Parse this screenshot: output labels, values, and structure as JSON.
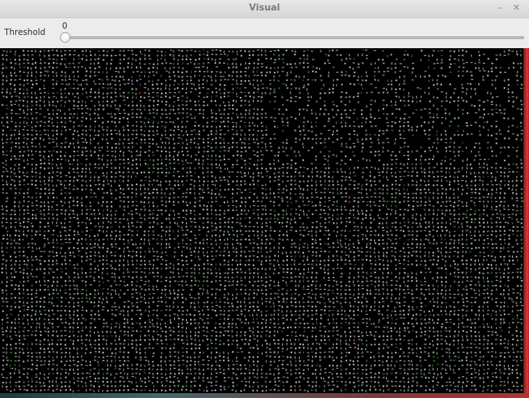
{
  "window": {
    "title": "Visual",
    "minimize_glyph": "–",
    "close_glyph": "✕"
  },
  "toolbar": {
    "threshold_label": "Threshold",
    "threshold_value": "0",
    "slider_fraction": 0
  },
  "visualization": {
    "background": "#000000",
    "dot_colors": [
      "#ffffff",
      "#dcdcdc",
      "#3fae3f",
      "#6b5b9a",
      "#c98b8b"
    ],
    "right_edge_color": "#c23030"
  }
}
